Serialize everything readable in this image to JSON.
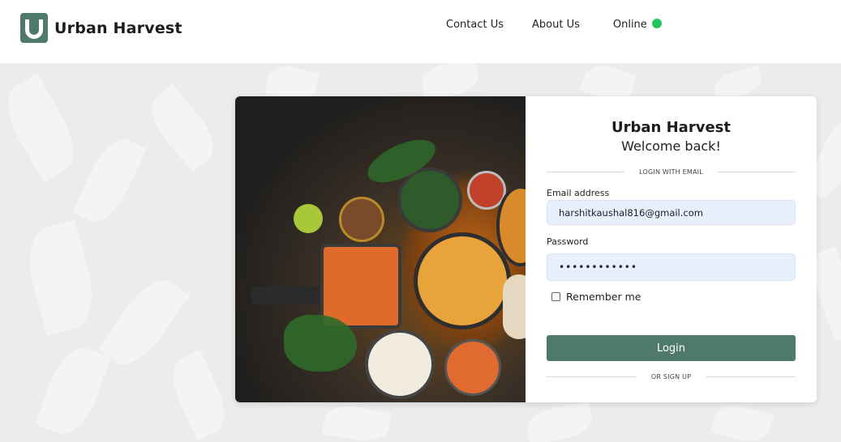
{
  "header": {
    "logo_letter": "U",
    "brand": "Urban Harvest",
    "nav": {
      "contact": "Contact Us",
      "about": "About Us",
      "online": "Online"
    },
    "online_color": "#22c55e"
  },
  "login": {
    "title": "Urban Harvest",
    "subtitle": "Welcome back!",
    "divider_top": "LOGIN WITH EMAIL",
    "email_label": "Email address",
    "email_value": "harshitkaushal816@gmail.com",
    "password_label": "Password",
    "password_value": "••••••••••••",
    "remember_label": "Remember me",
    "login_button": "Login",
    "divider_bottom": "OR SIGN UP"
  },
  "colors": {
    "accent": "#4f7a6b",
    "input_bg": "#e8f0fe"
  }
}
